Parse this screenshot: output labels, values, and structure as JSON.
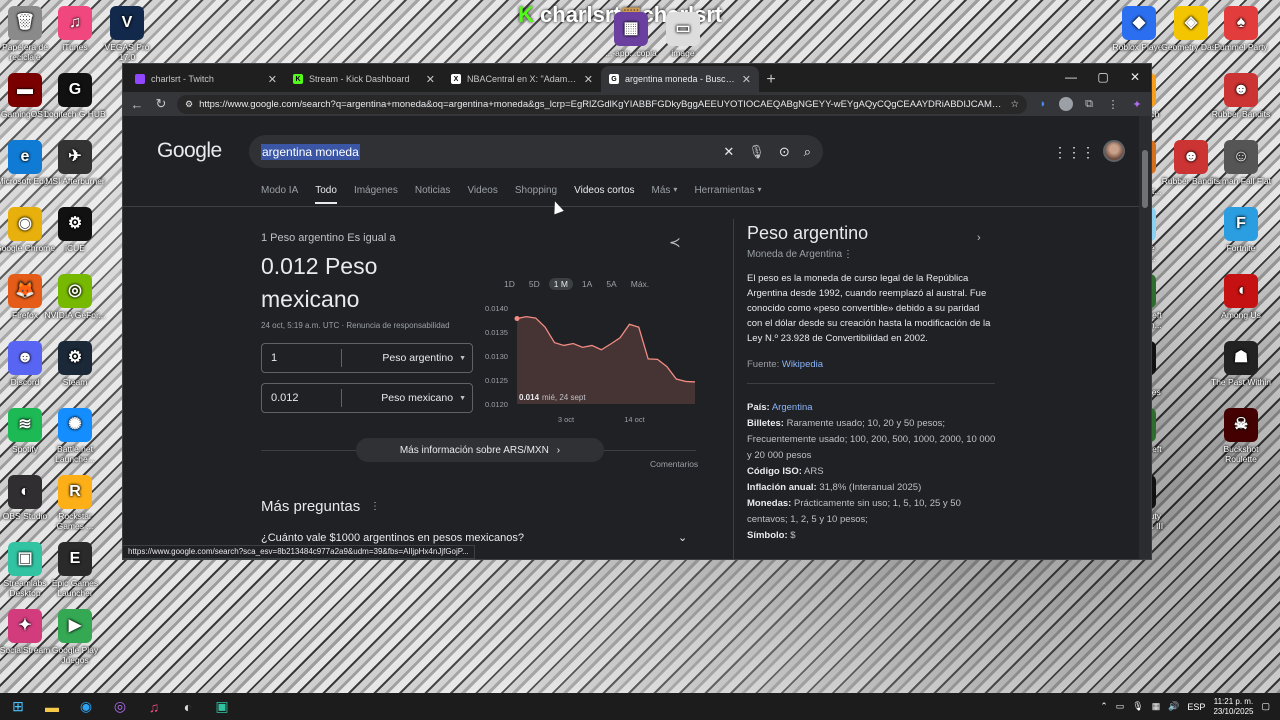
{
  "overlay_title": {
    "left": "charlsrt",
    "right": "charlsrt"
  },
  "desktop_left": [
    {
      "label": "Papelera de reciclaje",
      "icon": "recycle-bin-icon",
      "color": "#8a8a8a",
      "glyph": "🗑"
    },
    {
      "label": "GamingOSD",
      "icon": "gaming-osd-icon",
      "color": "#7a0000",
      "glyph": "▬"
    },
    {
      "label": "Microsoft Edge",
      "icon": "edge-icon",
      "color": "#0f7bd4",
      "glyph": "e"
    },
    {
      "label": "Google Chrome",
      "icon": "chrome-icon",
      "color": "#e8b00c",
      "glyph": "◉"
    },
    {
      "label": "Firefox",
      "icon": "firefox-icon",
      "color": "#e45c18",
      "glyph": "🦊"
    },
    {
      "label": "Discord",
      "icon": "discord-icon",
      "color": "#5865f2",
      "glyph": "☻"
    },
    {
      "label": "Spotify",
      "icon": "spotify-icon",
      "color": "#1db954",
      "glyph": "≋"
    },
    {
      "label": "OBS Studio",
      "icon": "obs-icon",
      "color": "#302e31",
      "glyph": "◐"
    },
    {
      "label": "Streamlabs Desktop",
      "icon": "streamlabs-icon",
      "color": "#31c3a2",
      "glyph": "▣"
    },
    {
      "label": "SocialStream",
      "icon": "socialstream-icon",
      "color": "#d23c7c",
      "glyph": "✦"
    }
  ],
  "desktop_left2": [
    {
      "label": "iTunes",
      "icon": "itunes-icon",
      "color": "#f0487e",
      "glyph": "♫"
    },
    {
      "label": "Logitech G HUB",
      "icon": "ghub-icon",
      "color": "#111",
      "glyph": "G"
    },
    {
      "label": "MSI Afterburner",
      "icon": "afterburner-icon",
      "color": "#333",
      "glyph": "✈"
    },
    {
      "label": "iCUE",
      "icon": "icue-icon",
      "color": "#111",
      "glyph": "⚙"
    },
    {
      "label": "NVIDIA GeFor...",
      "icon": "nvidia-icon",
      "color": "#76b900",
      "glyph": "◎"
    },
    {
      "label": "Steam",
      "icon": "steam-icon",
      "color": "#1b2838",
      "glyph": "⚙"
    },
    {
      "label": "Battle.net Launche...",
      "icon": "battlenet-icon",
      "color": "#148eff",
      "glyph": "✺"
    },
    {
      "label": "Rockstar Games ...",
      "icon": "rockstar-icon",
      "color": "#fcaf17",
      "glyph": "R"
    },
    {
      "label": "Epic Games Launcher",
      "icon": "epic-icon",
      "color": "#2a2a2a",
      "glyph": "E"
    },
    {
      "label": "Google Play Juegos",
      "icon": "play-games-icon",
      "color": "#34a853",
      "glyph": "▶"
    }
  ],
  "desktop_top": [
    {
      "label": "VEGAS Pro 17.0",
      "icon": "vegas-icon",
      "color": "#13294b",
      "glyph": "V"
    },
    {
      "label": "...-app...copia",
      "icon": "winrar-icon",
      "color": "#6b3fa0",
      "glyph": "▦"
    },
    {
      "label": "image",
      "icon": "image-file-icon",
      "color": "#ddd",
      "glyph": "▭"
    }
  ],
  "desktop_right2": [
    {
      "label": "Roblox Player",
      "icon": "roblox-icon",
      "color": "#2b6ff0",
      "glyph": "◆"
    },
    {
      "label": "Overwatch",
      "icon": "overwatch-icon",
      "color": "#f99e1a",
      "glyph": "◯"
    },
    {
      "label": "Crash Bandicoot...",
      "icon": "crash-icon",
      "color": "#d56f1b",
      "glyph": "☺"
    },
    {
      "label": "Ultimate Chicke...",
      "icon": "chicken-icon",
      "color": "#8bd1f2",
      "glyph": "🐔"
    },
    {
      "label": "Grand Theft Auto V En...",
      "icon": "gta-icon",
      "color": "#2f6d2f",
      "glyph": "V"
    },
    {
      "label": "Little Nightmares",
      "icon": "little-nightmares-icon",
      "color": "#111",
      "glyph": "◉"
    },
    {
      "label": "Grand Theft Auto V",
      "icon": "gta-icon",
      "color": "#2f6d2f",
      "glyph": "V"
    },
    {
      "label": "Call of Duty Black Ops III",
      "icon": "cod-icon",
      "color": "#111",
      "glyph": "III"
    }
  ],
  "desktop_right3": [
    {
      "label": "Geometry Dash",
      "icon": "geometry-dash-icon",
      "color": "#f3c400",
      "glyph": "◈"
    },
    {
      "label": "Pummel Party",
      "icon": "pummel-icon",
      "color": "#e23c3c",
      "glyph": "♠"
    }
  ],
  "desktop_right": [
    {
      "label": "Pummel Party",
      "icon": "pummel-icon",
      "color": "#e23c3c",
      "glyph": "♠"
    },
    {
      "label": "Rubber Bandits",
      "icon": "rubber-bandits-icon",
      "color": "#c33",
      "glyph": "☻"
    },
    {
      "label": "Human Fall Flat",
      "icon": "hff-icon",
      "color": "#555",
      "glyph": "☺"
    },
    {
      "label": "Fortnite",
      "icon": "fortnite-icon",
      "color": "#2a9ee0",
      "glyph": "F"
    },
    {
      "label": "Among Us",
      "icon": "among-us-icon",
      "color": "#c51111",
      "glyph": "◖"
    },
    {
      "label": "The Past Within",
      "icon": "past-within-icon",
      "color": "#222",
      "glyph": "☗"
    },
    {
      "label": "Buckshot Roulette",
      "icon": "buckshot-icon",
      "color": "#400",
      "glyph": "☠"
    }
  ],
  "browser": {
    "tabs": [
      {
        "label": "charlsrt - Twitch",
        "fav_color": "#9146ff",
        "fav_glyph": "",
        "icon": "twitch-icon",
        "active": false
      },
      {
        "label": "Stream - Kick Dashboard",
        "fav_color": "#53fc18",
        "fav_glyph": "K",
        "icon": "kick-icon",
        "active": false
      },
      {
        "label": "NBACentral en X: \"Adam Silver sa",
        "fav_color": "#fff",
        "fav_glyph": "X",
        "icon": "x-icon",
        "active": false
      },
      {
        "label": "argentina moneda - Buscar con G",
        "fav_color": "#fff",
        "fav_glyph": "G",
        "icon": "google-icon",
        "active": true
      }
    ],
    "url": "https://www.google.com/search?q=argentina+moneda&oq=argentina+moneda&gs_lcrp=EgRlZGdlKgYIABBFGDkyBggAEEUYOTIOCAEQABgNGEYY-wEYgAQyCQgCEAAYDRiABDIJCAMQABgNGIA..."
  },
  "google": {
    "logo": "Google",
    "query": "argentina moneda",
    "tabs": [
      "Modo IA",
      "Todo",
      "Imágenes",
      "Noticias",
      "Videos",
      "Shopping",
      "Videos cortos",
      "Más",
      "Herramientas"
    ],
    "converter": {
      "equals": "1 Peso argentino Es igual a",
      "result": "0.012 Peso mexicano",
      "meta": "24 oct, 5:19 a.m. UTC · Renuncia de responsabilidad",
      "from_value": "1",
      "from_currency": "Peso argentino",
      "to_value": "0.012",
      "to_currency": "Peso mexicano",
      "ranges": [
        "1D",
        "5D",
        "1 M",
        "1A",
        "5A",
        "Máx."
      ],
      "active_range": "1 M",
      "more_info": "Más información sobre ARS/MXN",
      "comments": "Comentarios"
    },
    "more_questions": {
      "title": "Más preguntas",
      "first": "¿Cuánto vale $1000 argentinos en pesos mexicanos?"
    },
    "knowledge_panel": {
      "title": "Peso argentino",
      "subtitle": "Moneda de Argentina",
      "description": "El peso es la moneda de curso legal de la República Argentina desde 1992, cuando reemplazó al austral. Fue conocido como «peso convertible» debido a su paridad con el dólar desde su creación hasta la modificación de la Ley N.º 23.928 de Convertibilidad en 2002.",
      "source_label": "Fuente:",
      "source_link": "Wikipedia",
      "facts": [
        {
          "k": "País:",
          "v": "Argentina",
          "link": true
        },
        {
          "k": "Billetes:",
          "v": "Raramente usado; 10, 20 y 50 pesos; Frecuentemente usado; 100, 200, 500, 1000, 2000, 10 000 y 20 000 pesos",
          "link": false
        },
        {
          "k": "Código ISO:",
          "v": "ARS",
          "link": false
        },
        {
          "k": "Inflación anual:",
          "v": "31,8% (Interanual 2025)",
          "link": false
        },
        {
          "k": "Monedas:",
          "v": "Prácticamente sin uso; 1, 5, 10, 25 y 50 centavos; 1, 2, 5 y 10 pesos;",
          "link": false
        },
        {
          "k": "Símbolo:",
          "v": "$",
          "link": false
        }
      ]
    },
    "status_url": "https://www.google.com/search?sca_esv=8b213484c977a2a9&udm=39&fbs=AIljpHx4nJjfGojP..."
  },
  "chart_data": {
    "type": "line",
    "title": "",
    "yticks": [
      "0.0140",
      "0.0135",
      "0.0130",
      "0.0125",
      "0.0120"
    ],
    "xticks": [
      "3 oct",
      "14 oct"
    ],
    "ylim": [
      0.012,
      0.014
    ],
    "tooltip": {
      "value": "0.014",
      "date": "mié, 24 sept"
    },
    "values": [
      0.01378,
      0.01382,
      0.01379,
      0.0136,
      0.01328,
      0.01322,
      0.01326,
      0.01318,
      0.01322,
      0.01313,
      0.01325,
      0.01338,
      0.01366,
      0.0136,
      0.01294,
      0.01293,
      0.01278,
      0.01252,
      0.01247,
      0.01246
    ],
    "color": "#f28b82"
  },
  "taskbar": {
    "apps": [
      "windows-start-icon",
      "file-explorer-icon",
      "edge-icon",
      "messenger-icon",
      "itunes-icon",
      "obs-icon",
      "streamlabs-icon"
    ],
    "lang": "ESP",
    "time": "11:21 p. m.",
    "date": "23/10/2025"
  }
}
